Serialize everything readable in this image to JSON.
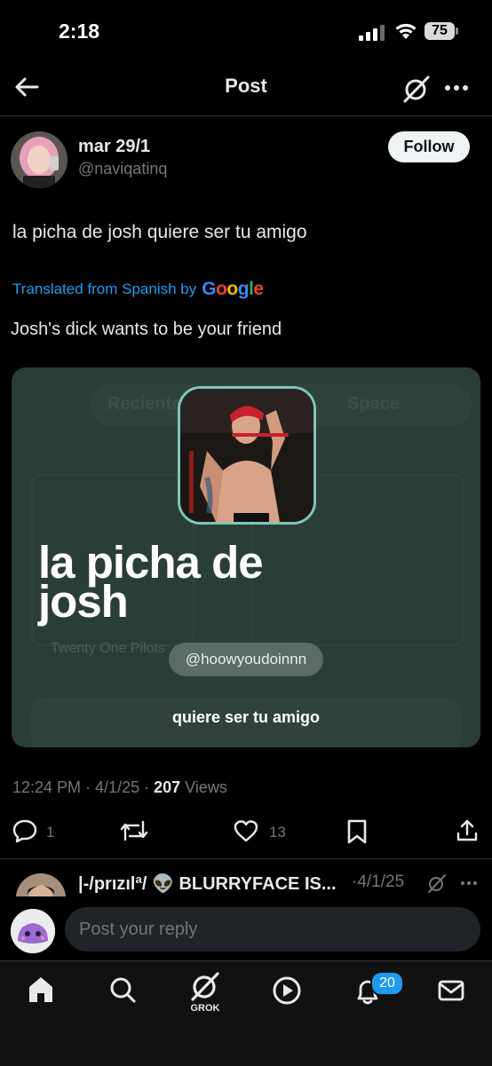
{
  "status_bar": {
    "time": "2:18",
    "battery": "75"
  },
  "header": {
    "title": "Post"
  },
  "author": {
    "name": "mar 29/1",
    "handle": "@naviqatinq",
    "follow_label": "Follow"
  },
  "post": {
    "text": "la picha de josh quiere ser tu amigo",
    "translated_prefix": "Translated from Spanish by",
    "translated_brand": "Google",
    "translation": "Josh's dick wants to be your friend"
  },
  "media_card": {
    "big_text_line1": "la picha de",
    "big_text_line2": "josh",
    "handle": "@hoowyoudoinnn",
    "subtitle": "quiere ser tu amigo",
    "ghost_text_1": "Recientes",
    "ghost_text_2": "Space",
    "ghost_text_3": "Twenty One Pilots"
  },
  "meta": {
    "time": "12:24 PM",
    "date": "4/1/25",
    "views_count": "207",
    "views_label": "Views"
  },
  "actions": {
    "replies": "1",
    "reposts": "",
    "likes": "13"
  },
  "reply_preview": {
    "name": "|-/prızılª/ 👽 BLURRYFACE IS...",
    "date": "·4/1/25"
  },
  "composer": {
    "placeholder": "Post your reply"
  },
  "bottom_nav": {
    "grok_label": "GROK",
    "notifications_count": "20"
  },
  "colors": {
    "accent": "#1d9bf0",
    "background": "#000000",
    "card": "#2b3d37",
    "muted": "#71767b"
  },
  "icons": [
    "back-arrow-icon",
    "grok-icon",
    "more-icon",
    "reply-icon",
    "repost-icon",
    "like-icon",
    "bookmark-icon",
    "share-icon",
    "home-icon",
    "search-icon",
    "play-icon",
    "bell-icon",
    "mail-icon"
  ]
}
